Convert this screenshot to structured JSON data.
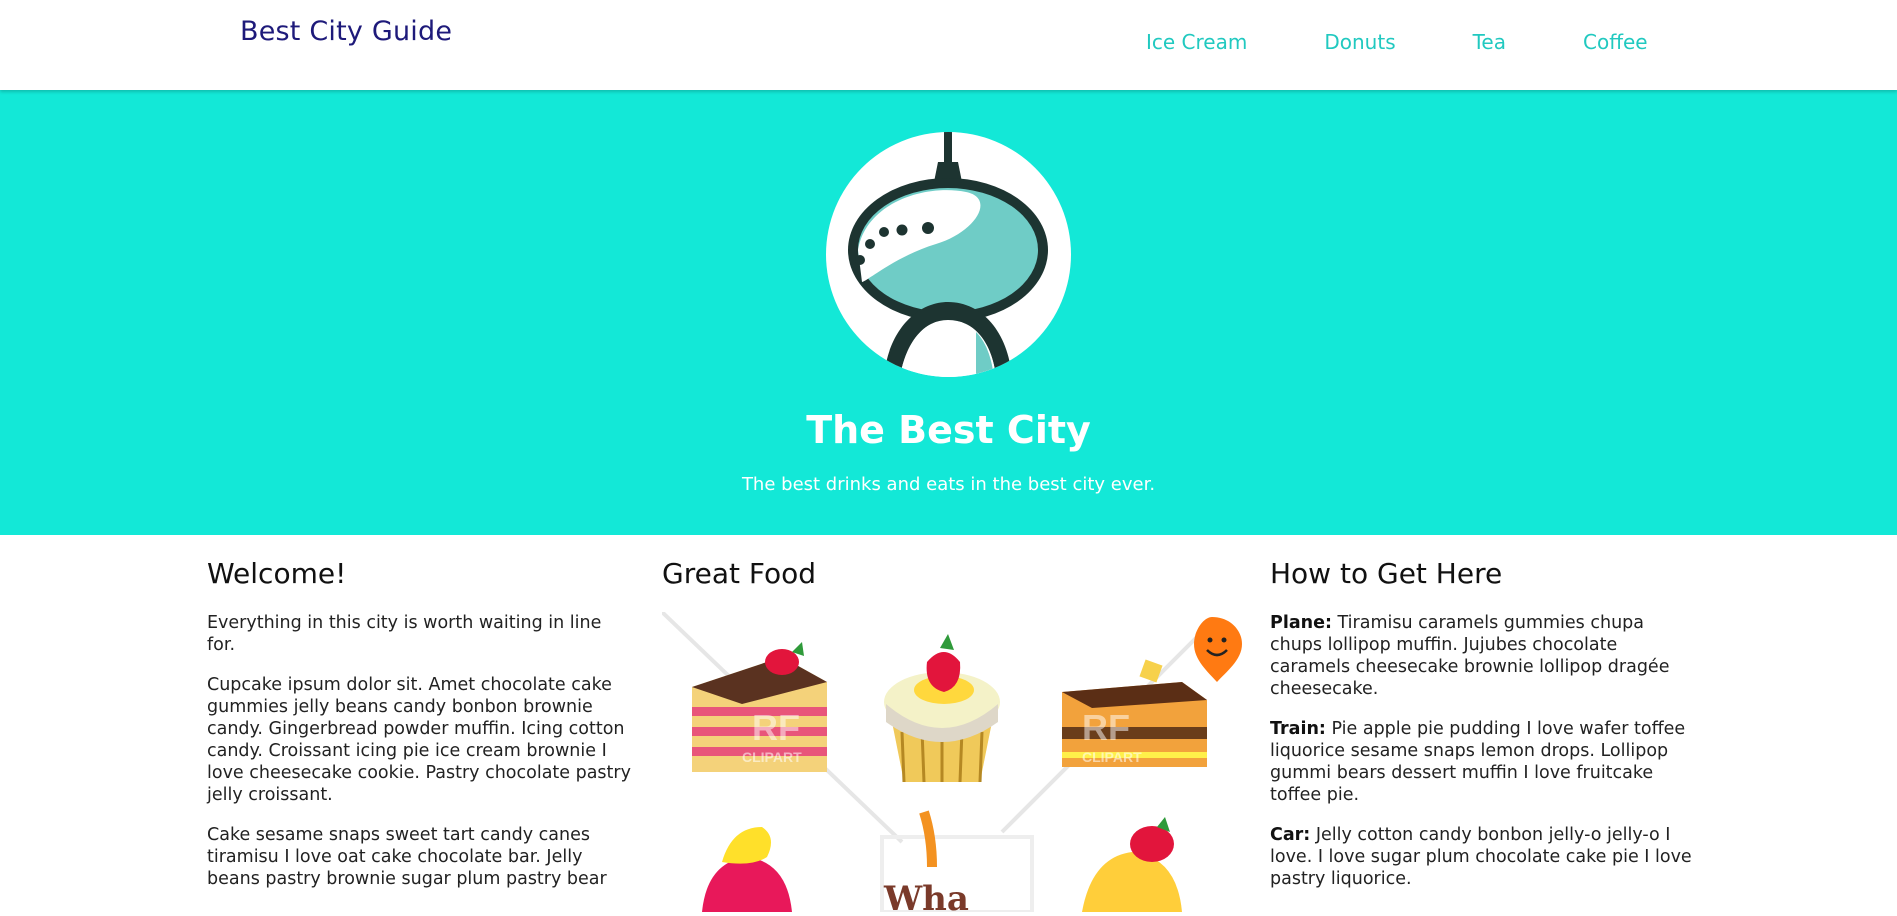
{
  "header": {
    "brand": "Best City Guide",
    "nav": [
      {
        "label": "Ice Cream"
      },
      {
        "label": "Donuts"
      },
      {
        "label": "Tea"
      },
      {
        "label": "Coffee"
      }
    ]
  },
  "hero": {
    "title": "The Best City",
    "subtitle": "The best drinks and eats in the best city ever."
  },
  "welcome": {
    "heading": "Welcome!",
    "p1": "Everything in this city is worth waiting in line for.",
    "p2": "Cupcake ipsum dolor sit. Amet chocolate cake gummies jelly beans candy bonbon brownie candy. Gingerbread powder muffin. Icing cotton candy. Croissant icing pie ice cream brownie I love cheesecake cookie. Pastry chocolate pastry jelly croissant.",
    "p3": "Cake sesame snaps sweet tart candy canes tiramisu I love oat cake chocolate bar. Jelly beans pastry brownie sugar plum pastry bear"
  },
  "food": {
    "heading": "Great Food",
    "watermark_1": "RF",
    "watermark_2": "CLIPART",
    "bottom_text": "Wha"
  },
  "directions": {
    "heading": "How to Get Here",
    "items": [
      {
        "label": "Plane:",
        "text": " Tiramisu caramels gummies chupa chups lollipop muffin. Jujubes chocolate caramels cheesecake brownie lollipop dragée cheesecake."
      },
      {
        "label": "Train:",
        "text": " Pie apple pie pudding I love wafer toffee liquorice sesame snaps lemon drops. Lollipop gummi bears dessert muffin I love fruitcake toffee pie."
      },
      {
        "label": "Car:",
        "text": " Jelly cotton candy bonbon jelly-o jelly-o I love. I love sugar plum chocolate cake pie I love pastry liquorice."
      }
    ]
  },
  "colors": {
    "brand": "#1e1a7a",
    "nav_link": "#21c9c0",
    "hero_bg": "#13e8d7",
    "hero_text": "#ffffff"
  }
}
